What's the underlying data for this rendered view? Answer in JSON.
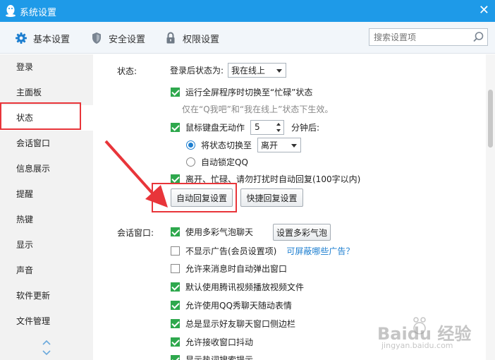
{
  "window": {
    "title": "系统设置",
    "close_glyph": "✕",
    "accent": "#1e9ae8"
  },
  "tabs": [
    {
      "label": "基本设置",
      "icon": "gear-icon",
      "active": true
    },
    {
      "label": "安全设置",
      "icon": "shield-icon"
    },
    {
      "label": "权限设置",
      "icon": "lock-icon"
    }
  ],
  "search": {
    "placeholder": "搜索设置项",
    "icon": "search-icon"
  },
  "sidebar": {
    "items": [
      {
        "label": "登录"
      },
      {
        "label": "主面板"
      },
      {
        "label": "状态",
        "active": true
      },
      {
        "label": "会话窗口"
      },
      {
        "label": "信息展示"
      },
      {
        "label": "提醒"
      },
      {
        "label": "热键"
      },
      {
        "label": "显示"
      },
      {
        "label": "声音"
      },
      {
        "label": "软件更新"
      },
      {
        "label": "文件管理"
      }
    ]
  },
  "status": {
    "label": "状态:",
    "after_login_label": "登录后状态为:",
    "after_login_value": "我在线上",
    "fullscreen_busy": {
      "label": "运行全屏程序时切换至“忙碌”状态",
      "checked": true
    },
    "fullscreen_hint": "仅在“Q我吧”和“我在线上”状态下生效。",
    "idle": {
      "label": "鼠标键盘无动作",
      "checked": true,
      "minutes": "5",
      "suffix": "分钟后:"
    },
    "idle_switch": {
      "label": "将状态切换至",
      "value": "离开",
      "selected": true
    },
    "idle_lock": {
      "label": "自动锁定QQ",
      "selected": false
    },
    "auto_reply": {
      "label": "离开、忙碌、请勿打扰时自动回复(100字以内)",
      "checked": true
    },
    "auto_reply_button": "自动回复设置",
    "quick_reply_button": "快捷回复设置"
  },
  "session": {
    "label": "会话窗口:",
    "options": [
      {
        "label": "使用多彩气泡聊天",
        "checked": true
      },
      {
        "label": "不显示广告(会员设置项)",
        "checked": false,
        "link": "可屏蔽哪些广告？"
      },
      {
        "label": "允许来消息时自动弹出窗口",
        "checked": false
      },
      {
        "label": "默认使用腾讯视频播放视频文件",
        "checked": true
      },
      {
        "label": "允许使用QQ秀聊天随动表情",
        "checked": true
      },
      {
        "label": "总是显示好友聊天窗口侧边栏",
        "checked": true
      },
      {
        "label": "允许接收窗口抖动",
        "checked": true
      },
      {
        "label": "显示热词搜索提示",
        "checked": true
      }
    ],
    "bubble_button": "设置多彩气泡"
  },
  "watermark": {
    "brand": "Baidu 经验",
    "url": "jingyan.baidu.com"
  }
}
